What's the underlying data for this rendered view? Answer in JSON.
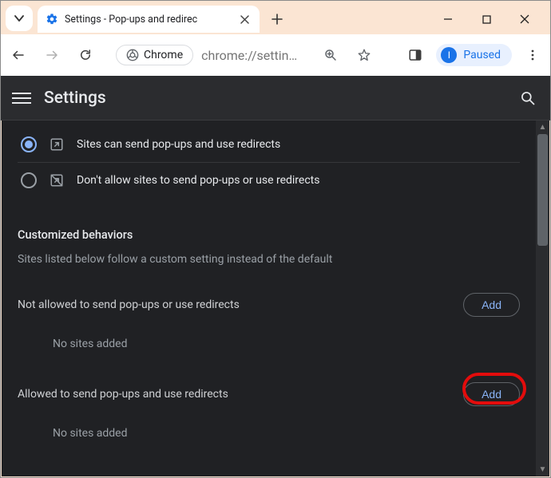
{
  "window": {
    "tab_title": "Settings - Pop-ups and redirec",
    "tab_close": "×",
    "new_tab": "+",
    "minimize": "—",
    "maximize": "□",
    "close": "×"
  },
  "toolbar": {
    "chrome_chip": "Chrome",
    "url": "chrome://settin…",
    "paused_label": "Paused",
    "avatar_initial": "I"
  },
  "header": {
    "title": "Settings"
  },
  "content": {
    "option_allow": "Sites can send pop-ups and use redirects",
    "option_block": "Don't allow sites to send pop-ups or use redirects",
    "section_heading": "Customized behaviors",
    "section_sub": "Sites listed below follow a custom setting instead of the default",
    "not_allowed_label": "Not allowed to send pop-ups or use redirects",
    "allowed_label": "Allowed to send pop-ups and use redirects",
    "add_label": "Add",
    "empty_text": "No sites added"
  }
}
